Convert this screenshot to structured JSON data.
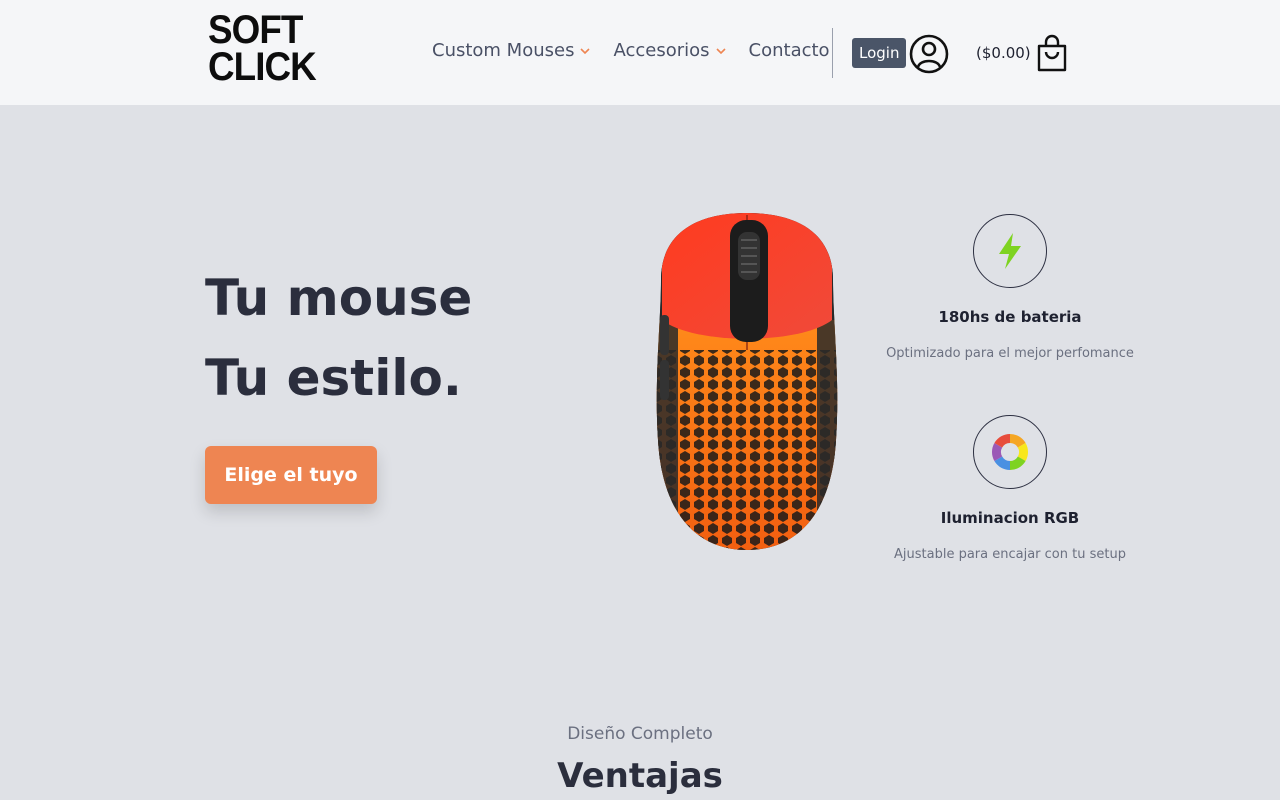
{
  "brand": {
    "line1": "SOFT",
    "line2": "CLICK"
  },
  "nav": {
    "items": [
      {
        "label": "Custom Mouses",
        "has_dropdown": true
      },
      {
        "label": "Accesorios",
        "has_dropdown": true
      },
      {
        "label": "Contacto",
        "has_dropdown": false
      }
    ]
  },
  "account": {
    "login_label": "Login",
    "user_icon": "user-circle-icon"
  },
  "cart": {
    "total": "($0.00)",
    "icon": "shopping-bag-icon"
  },
  "hero": {
    "title_line1": "Tu mouse",
    "title_line2": "Tu estilo.",
    "cta_label": "Elige el tuyo"
  },
  "features": [
    {
      "icon": "lightning-icon",
      "title": "180hs de bateria",
      "desc": "Optimizado para el mejor perfomance"
    },
    {
      "icon": "rgb-wheel-icon",
      "title": "Iluminacion RGB",
      "desc": "Ajustable para encajar con tu setup"
    }
  ],
  "section": {
    "subtitle": "Diseño Completo",
    "title": "Ventajas"
  },
  "colors": {
    "accent": "#ee8552",
    "nav_text": "#4a5166",
    "login_bg": "#4a5568",
    "background": "#dfe1e6",
    "header_bg": "#f5f6f8",
    "bolt": "#7ed321"
  }
}
